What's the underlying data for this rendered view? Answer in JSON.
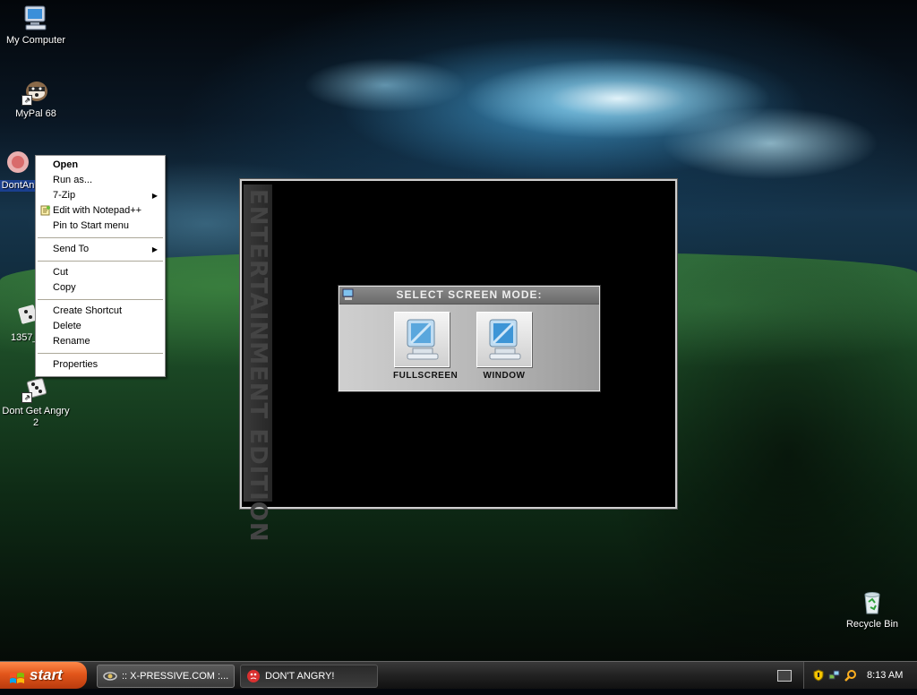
{
  "desktop": {
    "icons": [
      {
        "label": "My Computer",
        "icon": "my-computer-icon"
      },
      {
        "label": "MyPal 68",
        "icon": "mypal-browser-icon"
      },
      {
        "label": "DontAn",
        "icon": "dont-angry-icon"
      },
      {
        "label": "1357_s",
        "icon": "game-shortcut-icon"
      },
      {
        "label": "Dont Get Angry 2",
        "icon": "dice-icon"
      },
      {
        "label": "Recycle Bin",
        "icon": "recycle-bin-icon"
      }
    ]
  },
  "context_menu": {
    "items": [
      {
        "label": "Open",
        "bold": true
      },
      {
        "label": "Run as..."
      },
      {
        "label": "7-Zip",
        "submenu": true
      },
      {
        "label": "Edit with Notepad++",
        "icon": "notepad-plus-plus-icon"
      },
      {
        "label": "Pin to Start menu"
      },
      {
        "label": "Send To",
        "submenu": true
      },
      {
        "label": "Cut"
      },
      {
        "label": "Copy"
      },
      {
        "label": "Create Shortcut"
      },
      {
        "label": "Delete"
      },
      {
        "label": "Rename"
      },
      {
        "label": "Properties"
      }
    ]
  },
  "game_window": {
    "side_banner": "ENTERTAINMENT EDITION",
    "dialog_title": "SELECT SCREEN MODE:",
    "buttons": [
      {
        "label": "FULLSCREEN",
        "icon": "monitor-icon"
      },
      {
        "label": "WINDOW",
        "icon": "monitor-icon"
      }
    ]
  },
  "taskbar": {
    "start_label": "start",
    "tasks": [
      {
        "label": ":: X-PRESSIVE.COM :...",
        "icon": "xpressive-icon"
      },
      {
        "label": "DON'T ANGRY!",
        "icon": "dont-angry-icon"
      }
    ],
    "tray_icons": [
      "keyboard-icon",
      "security-shield-icon",
      "network-icon",
      "search-icon"
    ],
    "clock": "8:13 AM"
  },
  "colors": {
    "start_button": "#e2561b",
    "menu_separator": "#aca899"
  }
}
